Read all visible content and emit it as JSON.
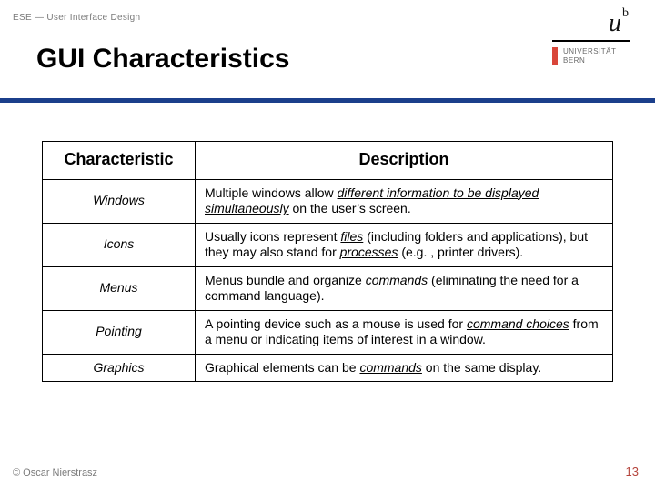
{
  "breadcrumb": "ESE — User Interface Design",
  "title": "GUI Characteristics",
  "logo": {
    "u": "u",
    "b": "b",
    "inst1": "UNIVERSITÄT",
    "inst2": "BERN"
  },
  "table": {
    "headers": {
      "c1": "Characteristic",
      "c2": "Description"
    },
    "rows": [
      {
        "name": "Windows",
        "desc_pre": "Multiple windows allow ",
        "desc_em": "different information to be displayed simultaneously",
        "desc_post": " on the user’s screen."
      },
      {
        "name": "Icons",
        "desc_pre": "Usually icons represent ",
        "desc_em": "files",
        "desc_mid": " (including folders and applications), but they may also stand for ",
        "desc_em2": "processes",
        "desc_post": " (e.g. , printer drivers)."
      },
      {
        "name": "Menus",
        "desc_pre": "Menus bundle and organize ",
        "desc_em": "commands",
        "desc_post": " (eliminating the need for a command language)."
      },
      {
        "name": "Pointing",
        "desc_pre": "A pointing device such as a mouse is used for ",
        "desc_em": "command choices",
        "desc_post": " from a menu or indicating items of interest in a window."
      },
      {
        "name": "Graphics",
        "desc_pre": "Graphical elements can be ",
        "desc_em": "commands",
        "desc_post": " on the same display."
      }
    ]
  },
  "footer": {
    "copyright": "© Oscar Nierstrasz",
    "page": "13"
  }
}
